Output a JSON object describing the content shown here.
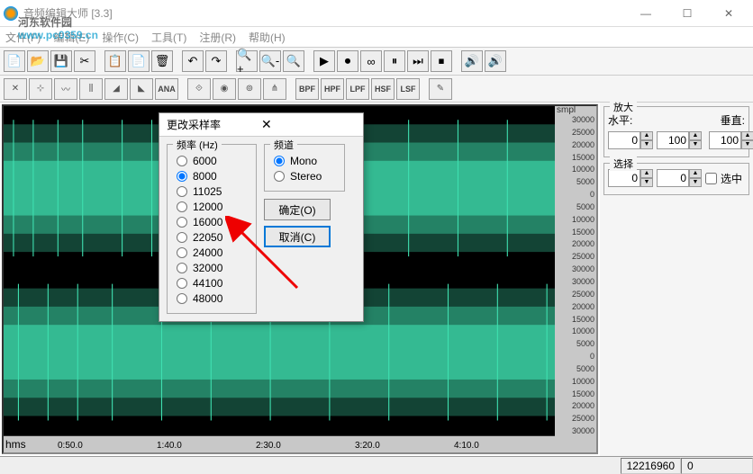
{
  "window": {
    "title": "音频编辑大师 [3.3]",
    "min": "—",
    "max": "☐",
    "close": "✕"
  },
  "watermark": {
    "main": "河东软件园",
    "sub": "www.pc0359.cn"
  },
  "menu": {
    "file": "文件(F)",
    "edit": "编辑(E)",
    "operate": "操作(C)",
    "tools": "工具(T)",
    "register": "注册(R)",
    "help": "帮助(H)"
  },
  "ruler": {
    "smpl": "smpl",
    "right_ticks_top": [
      "30000",
      "25000",
      "20000",
      "15000",
      "10000",
      "5000",
      "0",
      "5000",
      "10000",
      "15000",
      "20000",
      "25000",
      "30000"
    ],
    "right_ticks_bot": [
      "30000",
      "25000",
      "20000",
      "15000",
      "10000",
      "5000",
      "0",
      "5000",
      "10000",
      "15000",
      "20000",
      "25000",
      "30000"
    ],
    "hms": "hms",
    "x_ticks": [
      "0:50.0",
      "1:40.0",
      "2:30.0",
      "3:20.0",
      "4:10.0"
    ]
  },
  "panel": {
    "zoom_title": "放大",
    "horiz": "水平:",
    "vert": "垂直:",
    "h1": "0",
    "h2": "100",
    "v": "100",
    "sel_title": "选择",
    "s1": "0",
    "s2": "0",
    "sel_chk": "选中"
  },
  "dialog": {
    "title": "更改采样率",
    "freq_title": "频率 (Hz)",
    "freqs": [
      "6000",
      "8000",
      "11025",
      "12000",
      "16000",
      "22050",
      "24000",
      "32000",
      "44100",
      "48000"
    ],
    "freq_selected": "8000",
    "chan_title": "频道",
    "mono": "Mono",
    "stereo": "Stereo",
    "ok": "确定(O)",
    "cancel": "取消(C)"
  },
  "status": {
    "pos": "12216960",
    "total": "0"
  }
}
